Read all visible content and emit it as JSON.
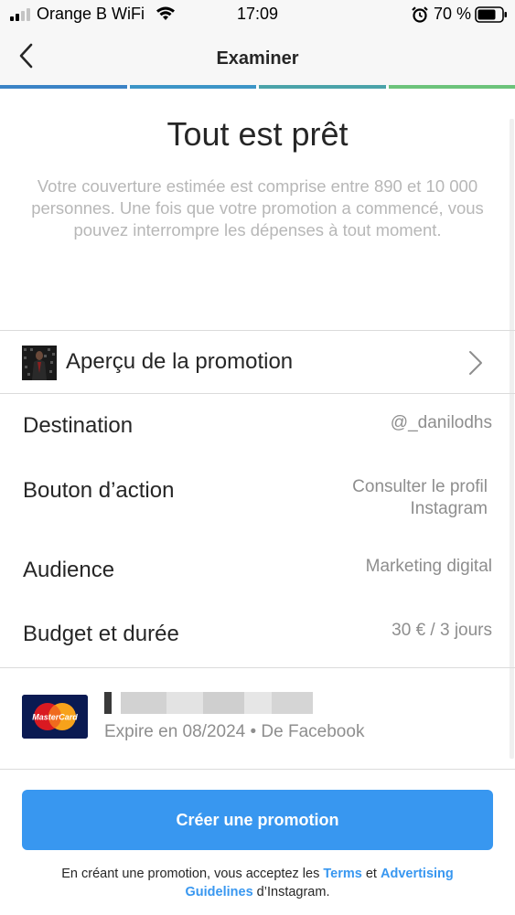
{
  "status_bar": {
    "carrier": "Orange B WiFi",
    "time": "17:09",
    "battery": "70 %"
  },
  "nav": {
    "title": "Examiner",
    "back_icon": "chevron-left-icon"
  },
  "progress": {
    "steps": [
      "#3b83c6",
      "#3c95c7",
      "#4aa3a9",
      "#6cc37a"
    ]
  },
  "header": {
    "headline": "Tout est prêt",
    "subtext": "Votre couverture estimée est comprise entre 890 et 10 000 personnes. Une fois que votre promotion a commencé, vous pouvez interrompre les dépenses à tout moment."
  },
  "preview": {
    "label": "Aperçu de la promotion"
  },
  "details": {
    "destination": {
      "label": "Destination",
      "value": "@_danilodhs"
    },
    "action": {
      "label": "Bouton d’action",
      "value_line1": "Consulter le profil",
      "value_line2": "Instagram"
    },
    "audience": {
      "label": "Audience",
      "value": "Marketing digital"
    },
    "budget": {
      "label": "Budget et durée",
      "value": "30 € / 3 jours"
    }
  },
  "payment": {
    "card_brand": "MasterCard",
    "expiry": "Expire en 08/2024 • De Facebook"
  },
  "cta": {
    "label": "Créer une promotion"
  },
  "legal": {
    "prefix": "En créant une promotion, vous acceptez les ",
    "terms": "Terms",
    "and": " et ",
    "guidelines_1": "Advertising",
    "guidelines_2": "Guidelines",
    "suffix": " d’Instagram."
  },
  "colors": {
    "accent": "#3897f0",
    "text": "#262626",
    "muted": "#8e8e8e",
    "subtle": "#b7b7b7"
  }
}
